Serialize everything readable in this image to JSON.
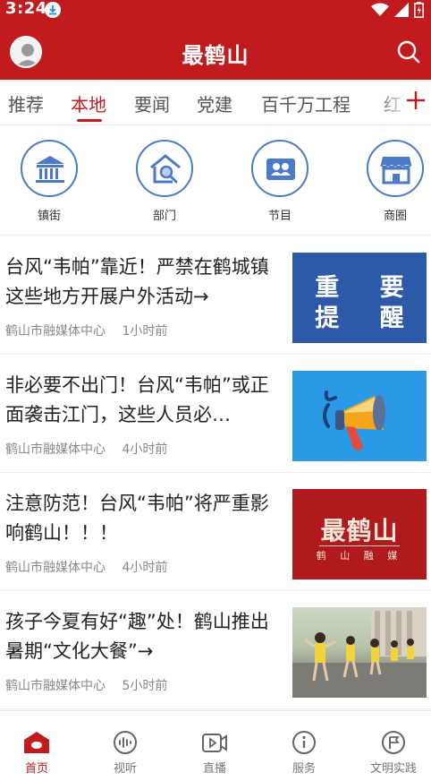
{
  "status_bar": {
    "time": "3:24"
  },
  "header": {
    "title": "最鹤山"
  },
  "tabs": [
    {
      "label": "推荐"
    },
    {
      "label": "本地"
    },
    {
      "label": "要闻"
    },
    {
      "label": "党建"
    },
    {
      "label": "百千万工程"
    },
    {
      "label": "红"
    }
  ],
  "active_tab": "本地",
  "quick_nav": [
    {
      "label": "镇街",
      "icon": "bank-icon"
    },
    {
      "label": "部门",
      "icon": "home-search-icon"
    },
    {
      "label": "节目",
      "icon": "id-card-icon"
    },
    {
      "label": "商圈",
      "icon": "store-icon"
    }
  ],
  "news": [
    {
      "title": "台风“韦帕”靠近！严禁在鹤城镇这些地方开展户外活动→",
      "source": "鹤山市融媒体中心",
      "time": "1小时前",
      "thumb_text": [
        "重 要",
        "提 醒"
      ]
    },
    {
      "title": "非必要不出门！台风“韦帕”或正面袭击江门，这些人员必…",
      "source": "鹤山市融媒体中心",
      "time": "4小时前",
      "thumb_icon": "megaphone-icon"
    },
    {
      "title": "注意防范！台风“韦帕”将严重影响鹤山！！！",
      "source": "鹤山市融媒体中心",
      "time": "4小时前",
      "thumb_text": [
        "最鹤山",
        "鹤 山 融 媒"
      ]
    },
    {
      "title": "孩子今夏有好“趣”处！鹤山推出暑期“文化大餐”→",
      "source": "鹤山市融媒体中心",
      "time": "5小时前",
      "thumb_icon": "photo-children-dancing"
    }
  ],
  "bottom_nav": [
    {
      "label": "首页",
      "icon": "home-icon",
      "active": true
    },
    {
      "label": "视听",
      "icon": "audio-icon",
      "active": false
    },
    {
      "label": "直播",
      "icon": "video-icon",
      "active": false
    },
    {
      "label": "服务",
      "icon": "info-icon",
      "active": false
    },
    {
      "label": "文明实践",
      "icon": "flag-icon",
      "active": false
    }
  ],
  "colors": {
    "brand_red": "#c21b1f",
    "icon_blue": "#4a7ac8"
  }
}
